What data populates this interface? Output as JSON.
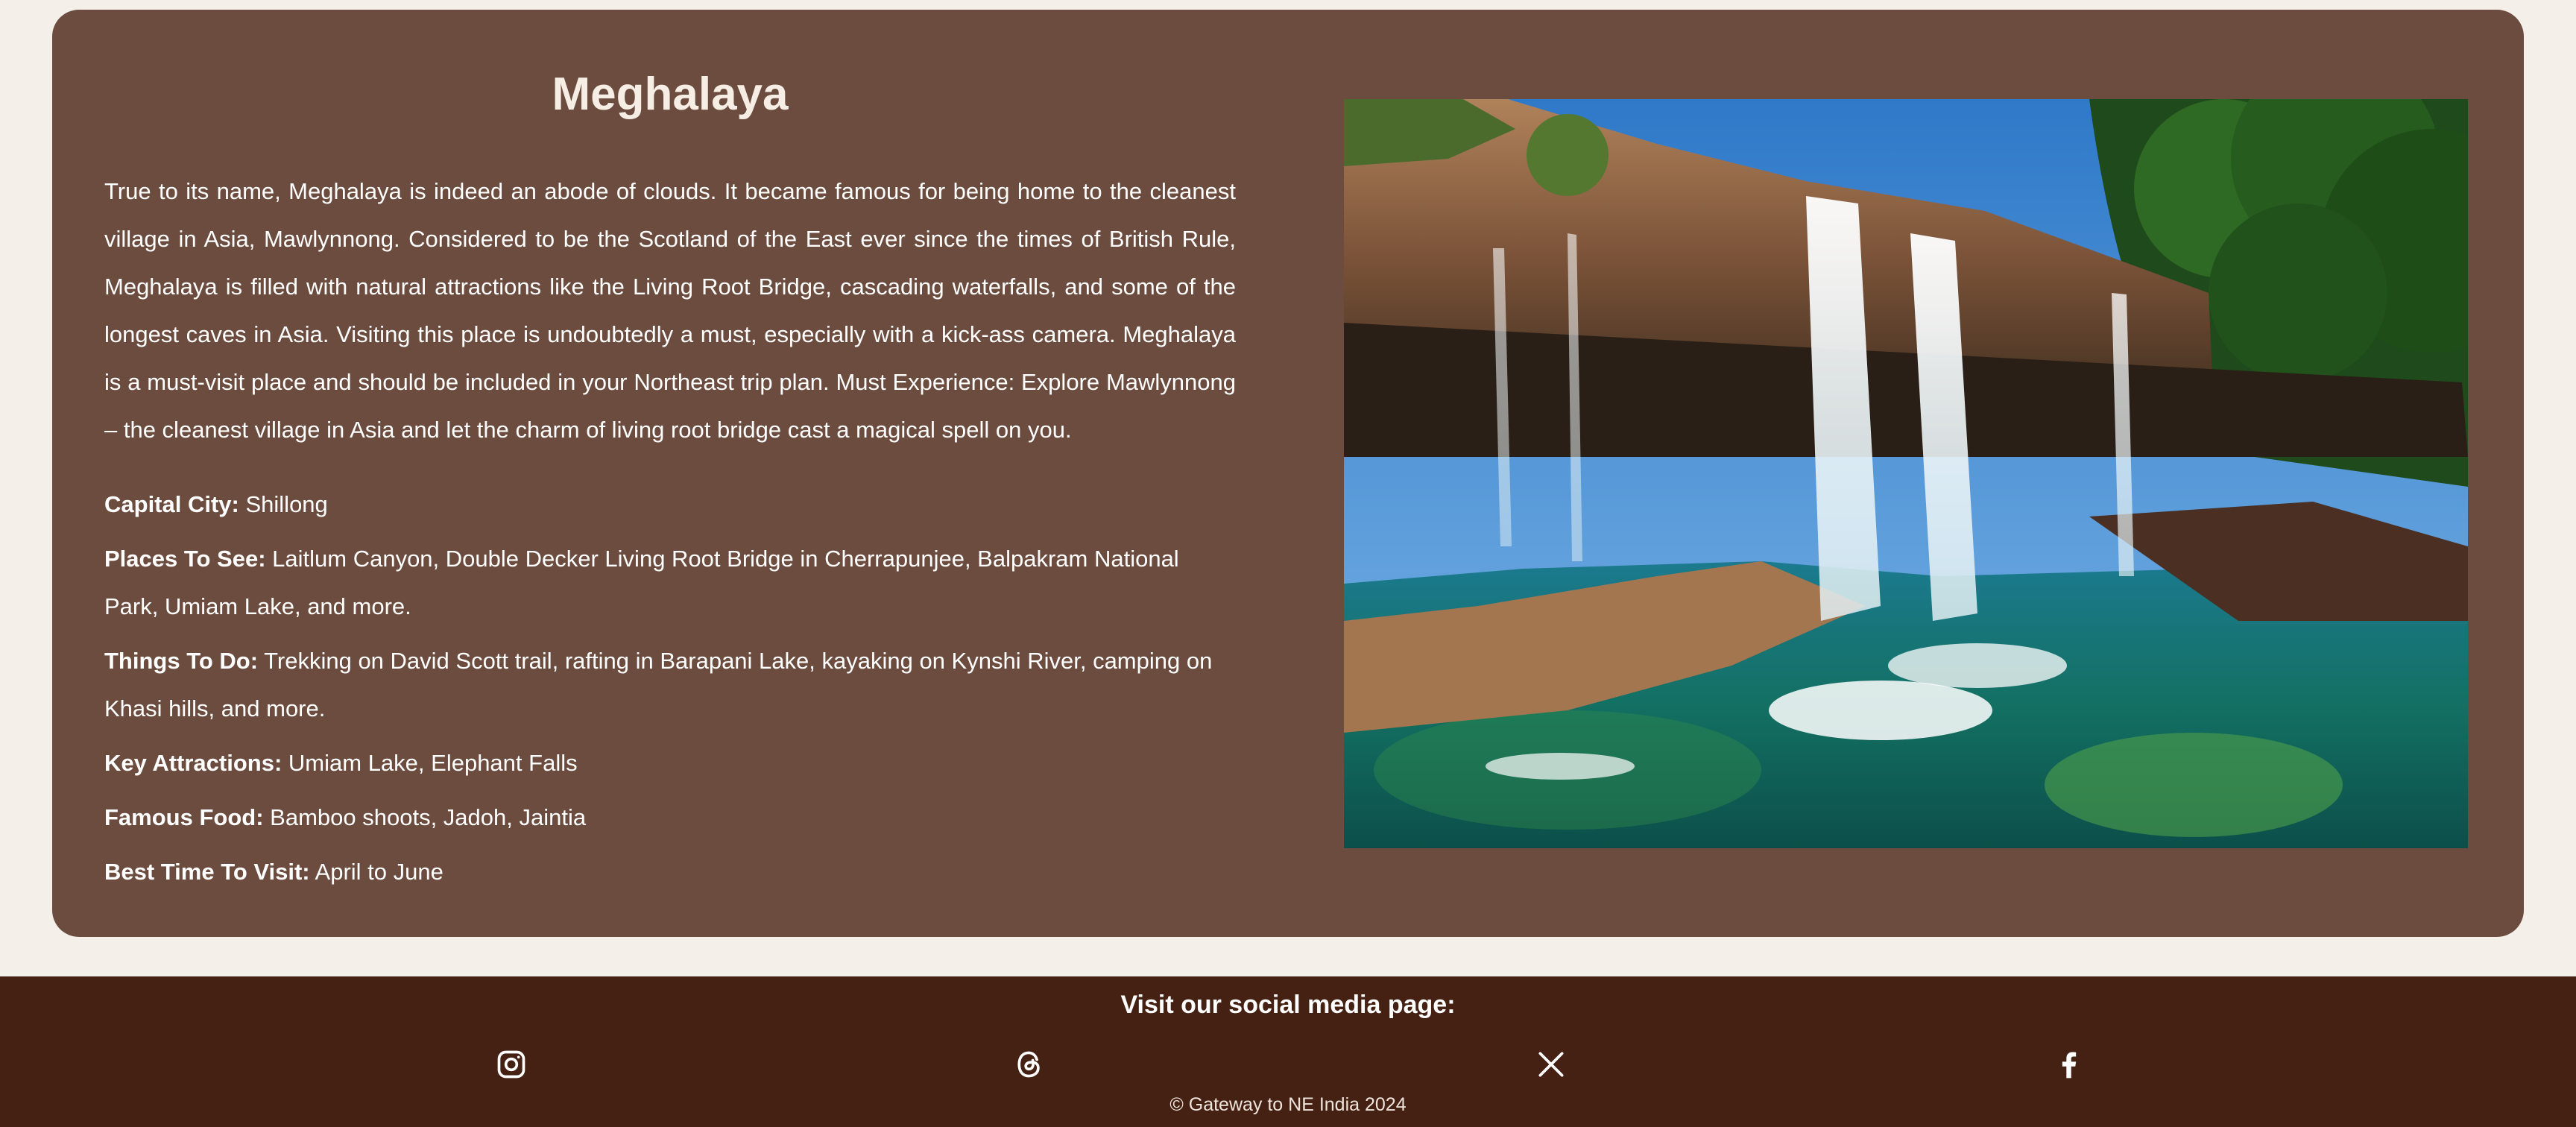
{
  "card": {
    "title": "Meghalaya",
    "description": "True to its name, Meghalaya is indeed an abode of clouds. It became famous for being home to the cleanest village in Asia, Mawlynnong. Considered to be the Scotland of the East ever since the times of British Rule, Meghalaya is filled with natural attractions like the Living Root Bridge, cascading waterfalls, and some of the longest caves in Asia. Visiting this place is undoubtedly a must, especially with a kick-ass camera. Meghalaya is a must-visit place and should be included in your Northeast trip plan. Must Experience: Explore Mawlynnong – the cleanest village in Asia and let the charm of living root bridge cast a magical spell on you.",
    "facts": [
      {
        "label": "Capital City:",
        "value": "Shillong"
      },
      {
        "label": "Places To See:",
        "value": "Laitlum Canyon, Double Decker Living Root Bridge in Cherrapunjee, Balpakram National Park, Umiam Lake, and more."
      },
      {
        "label": "Things To Do:",
        "value": "Trekking on David Scott trail, rafting in Barapani Lake, kayaking on Kynshi River, camping on Khasi hills, and more."
      },
      {
        "label": "Key Attractions:",
        "value": "Umiam Lake, Elephant Falls"
      },
      {
        "label": "Famous Food:",
        "value": "Bamboo shoots, Jadoh, Jaintia"
      },
      {
        "label": "Best Time To Visit:",
        "value": "April to June"
      }
    ]
  },
  "footer": {
    "heading": "Visit our social media page:",
    "social_icons": [
      "instagram-icon",
      "threads-icon",
      "x-icon",
      "facebook-icon"
    ],
    "copyright": "© Gateway to NE India 2024"
  },
  "colors": {
    "page_background": "#f5efe9",
    "card_background": "#6c4c3e",
    "footer_background": "#452114",
    "text": "#ffffff"
  }
}
